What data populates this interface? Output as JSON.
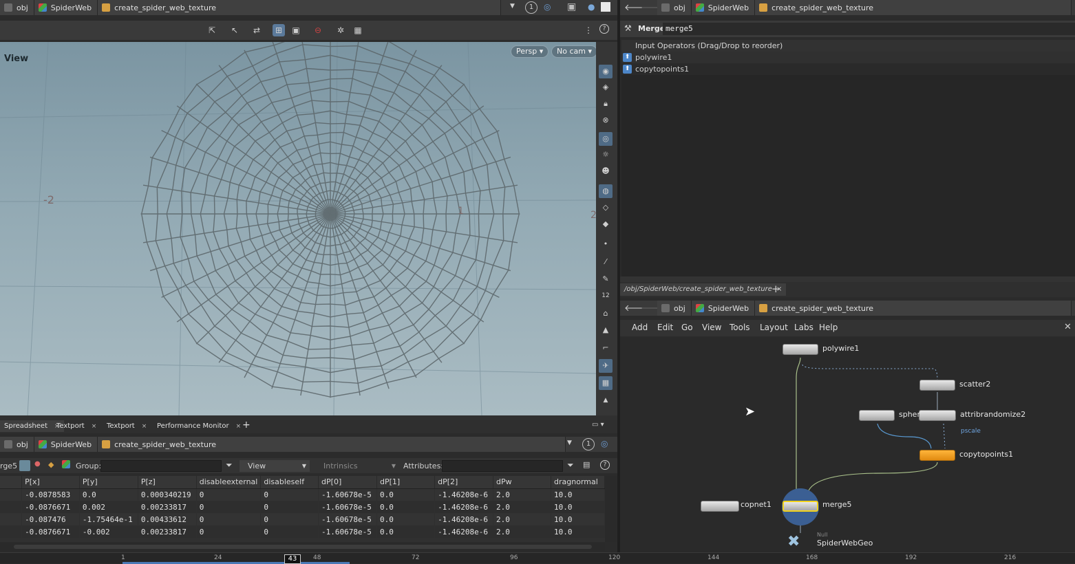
{
  "breadcrumb": {
    "obj": "obj",
    "geo": "SpiderWeb",
    "subnet": "create_spider_web_texture"
  },
  "viewer": {
    "label": "View",
    "persp_button": "Persp ▾",
    "cam_button": "No cam ▾",
    "grid_labels": [
      "-2",
      "1",
      "2"
    ],
    "top_right_indicator": "1"
  },
  "parameters": {
    "node_type": "Merge",
    "node_name": "merge5",
    "input_header": "Input Operators (Drag/Drop to reorder)",
    "inputs": [
      "polywire1",
      "copytopoints1"
    ]
  },
  "network": {
    "path_tab": "/obj/SpiderWeb/create_spider_web_texture",
    "menu": [
      "Add",
      "Edit",
      "Go",
      "View",
      "Tools",
      "Layout",
      "Labs",
      "Help"
    ],
    "nodes": {
      "polywire1": "polywire1",
      "scatter2": "scatter2",
      "sphere": "spher",
      "attribrandomize2": "attribrandomize2",
      "pscale": "pscale",
      "copytopoints1": "copytopoints1",
      "copnet1": "copnet1",
      "merge5": "merge5",
      "null_type": "Null",
      "spiderwebgeo": "SpiderWebGeo"
    }
  },
  "bottom_tabs": [
    "Spreadsheet",
    "Textport",
    "Textport",
    "Performance Monitor"
  ],
  "spreadsheet": {
    "node_label": "rge5",
    "group_label": "Group:",
    "view_option": "View",
    "intrinsics_option": "Intrinsics",
    "attributes_label": "Attributes:",
    "indicator": "1",
    "columns": [
      "P[x]",
      "P[y]",
      "P[z]",
      "disableexternal",
      "disableself",
      "dP[0]",
      "dP[1]",
      "dP[2]",
      "dPw",
      "dragnormal"
    ],
    "rows": [
      [
        "-0.0878583",
        "0.0",
        "0.000340219",
        "0",
        "0",
        "-1.60678e-5",
        "0.0",
        "-1.46208e-6",
        "2.0",
        "10.0"
      ],
      [
        "-0.0876671",
        "0.002",
        "0.00233817",
        "0",
        "0",
        "-1.60678e-5",
        "0.0",
        "-1.46208e-6",
        "2.0",
        "10.0"
      ],
      [
        "-0.087476",
        "-1.75464e-1",
        "0.00433612",
        "0",
        "0",
        "-1.60678e-5",
        "0.0",
        "-1.46208e-6",
        "2.0",
        "10.0"
      ],
      [
        "-0.0876671",
        "-0.002",
        "0.00233817",
        "0",
        "0",
        "-1.60678e-5",
        "0.0",
        "-1.46208e-6",
        "2.0",
        "10.0"
      ]
    ]
  },
  "timeline": {
    "ticks": [
      "1",
      "24",
      "48",
      "72",
      "96",
      "120",
      "144",
      "168",
      "192",
      "216"
    ],
    "current_frame": "43"
  }
}
